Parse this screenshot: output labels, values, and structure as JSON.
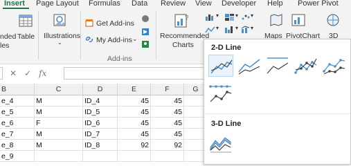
{
  "tabs": [
    "Insert",
    "Page Layout",
    "Formulas",
    "Data",
    "Review",
    "View",
    "Developer",
    "Help",
    "Power Pivot"
  ],
  "ribbon": {
    "recommended_pivottables_partial_line1": "nded",
    "recommended_pivottables_partial_line2": "les",
    "table_label": "Table",
    "illustrations_label": "Illustrations",
    "get_addins_label": "Get Add-ins",
    "my_addins_label": "My Add-ins",
    "addins_group_label": "Add-ins",
    "recommended_charts_line1": "Recommended",
    "recommended_charts_line2": "Charts",
    "maps_label": "Maps",
    "pivotchart_label": "PivotChart",
    "threed_label": "3D"
  },
  "formula_bar": {
    "cancel_glyph": "✕",
    "enter_glyph": "✓",
    "fx_label": "fx",
    "value": ""
  },
  "grid": {
    "columns": [
      "B",
      "C",
      "D",
      "E",
      "F",
      "G"
    ],
    "rows": [
      {
        "b": "e_4",
        "c": "M",
        "d": "ID_4",
        "e": "45",
        "f": "45"
      },
      {
        "b": "e_5",
        "c": "M",
        "d": "ID_5",
        "e": "45",
        "f": "45"
      },
      {
        "b": "e_6",
        "c": "F",
        "d": "ID_6",
        "e": "45",
        "f": "45"
      },
      {
        "b": "e_7",
        "c": "M",
        "d": "ID_7",
        "e": "45",
        "f": "45"
      },
      {
        "b": "e_8",
        "c": "M",
        "d": "ID_8",
        "e": "92",
        "f": "92"
      },
      {
        "b": "e_9",
        "c": "",
        "d": "",
        "e": "",
        "f": ""
      }
    ]
  },
  "dropdown": {
    "section_2d": "2-D Line",
    "section_3d": "3-D Line"
  },
  "colors": {
    "excel_green": "#217346",
    "chart_blue": "#4a90c8",
    "chart_dark": "#404040"
  }
}
